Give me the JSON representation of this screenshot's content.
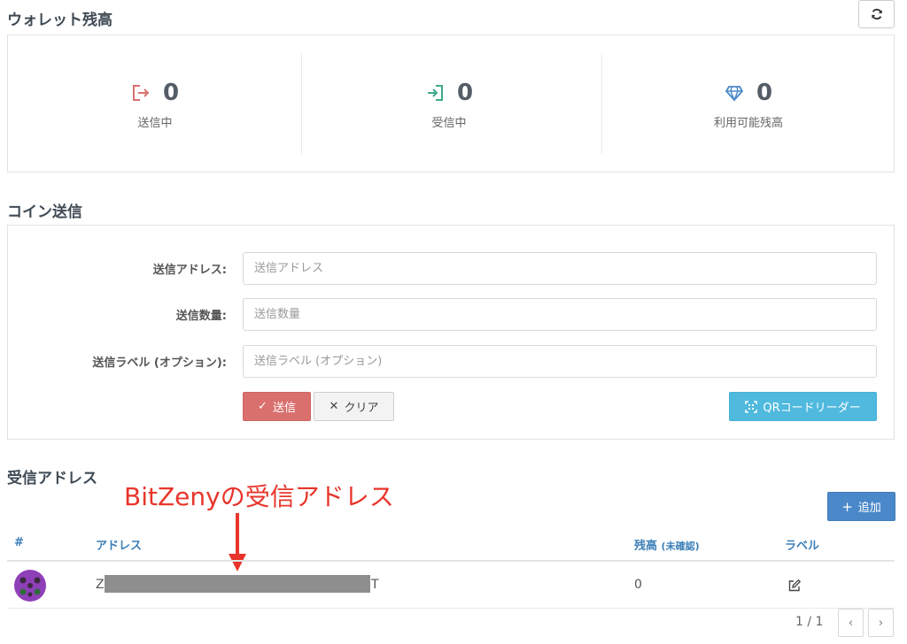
{
  "balance": {
    "title": "ウォレット残高",
    "sending": {
      "value": "0",
      "label": "送信中"
    },
    "receiving": {
      "value": "0",
      "label": "受信中"
    },
    "available": {
      "value": "0",
      "label": "利用可能残高"
    }
  },
  "send": {
    "title": "コイン送信",
    "address_label": "送信アドレス:",
    "address_placeholder": "送信アドレス",
    "amount_label": "送信数量:",
    "amount_placeholder": "送信数量",
    "tag_label": "送信ラベル (オプション):",
    "tag_placeholder": "送信ラベル (オプション)",
    "send_button": "送信",
    "clear_button": "クリア",
    "qr_button": "QRコードリーダー"
  },
  "receive": {
    "title": "受信アドレス",
    "add_button": "追加",
    "columns": {
      "index": "#",
      "address": "アドレス",
      "balance": "残高",
      "balance_sub": "(未確認)",
      "label": "ラベル"
    },
    "rows": [
      {
        "address_start": "Z",
        "address_end": "T",
        "balance": "0"
      }
    ],
    "pagination": "1 / 1"
  },
  "annotation": "BitZenyの受信アドレス",
  "colors": {
    "send": "#d9706e",
    "qr": "#4fb9de",
    "add": "#4a88c9",
    "header_link": "#3b7fb8",
    "annotation": "#e8352b"
  }
}
